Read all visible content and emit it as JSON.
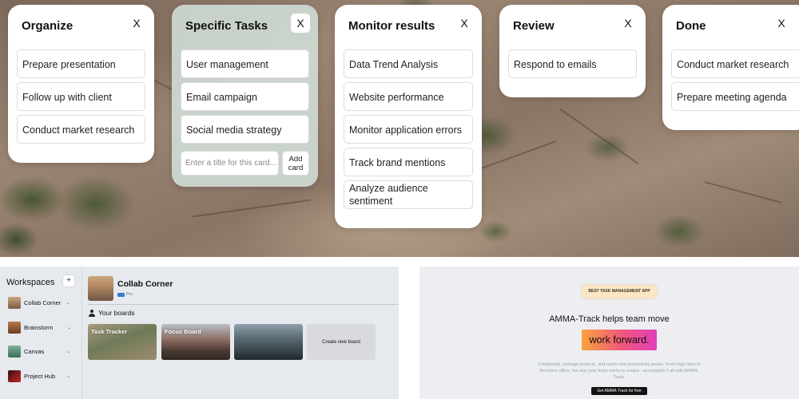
{
  "kanban": {
    "columns": [
      {
        "title": "Organize",
        "close": "X",
        "cards": [
          "Prepare presentation",
          "Follow up with client",
          "Conduct market research"
        ]
      },
      {
        "title": "Specific Tasks",
        "close": "X",
        "cards": [
          "User management",
          "Email campaign",
          "Social media strategy"
        ],
        "add_card": {
          "placeholder": "Enter a title for this card...",
          "button": "Add card"
        }
      },
      {
        "title": "Monitor results",
        "close": "X",
        "cards": [
          "Data Trend Analysis",
          "Website performance",
          "Monitor application errors",
          "Track brand mentions",
          "Analyze audience sentiment"
        ]
      },
      {
        "title": "Review",
        "close": "X",
        "cards": [
          "Respond to emails"
        ]
      },
      {
        "title": "Done",
        "close": "X",
        "cards": [
          "Conduct market research",
          "Prepare meeting agenda"
        ]
      }
    ]
  },
  "workspaces": {
    "title": "Workspaces",
    "add": "+",
    "items": [
      {
        "label": "Collab Corner",
        "thumb_color": "#a07a5a"
      },
      {
        "label": "Brainstorm",
        "thumb_color": "#8a5a3a"
      },
      {
        "label": "Canvas",
        "thumb_color": "#5a8a6a"
      },
      {
        "label": "Project Hub",
        "thumb_color": "#b22a2a"
      }
    ],
    "current_board": {
      "name": "Collab Corner",
      "badge": "Pro"
    },
    "your_boards_label": "Your boards",
    "boards": [
      {
        "label": "Task Tracker"
      },
      {
        "label": "Focus Board"
      },
      {
        "label": ""
      }
    ],
    "create_label": "Create new board"
  },
  "promo": {
    "pill": "BEST TASK MANAGEMENT APP",
    "headline": "AMMA-Track helps team move",
    "highlight": "work forward.",
    "body": "Collaborate, manage projects, and reach new productivity peaks. From high rises to the home office, the way your team works is unique - accomplish it all with AMMA-Track.",
    "cta": "Get AMMA-Track for free"
  },
  "colors": {
    "brand_gradient_start": "#f9a23b",
    "brand_gradient_end": "#e23fb8",
    "badge_blue": "#3c7ad6"
  }
}
